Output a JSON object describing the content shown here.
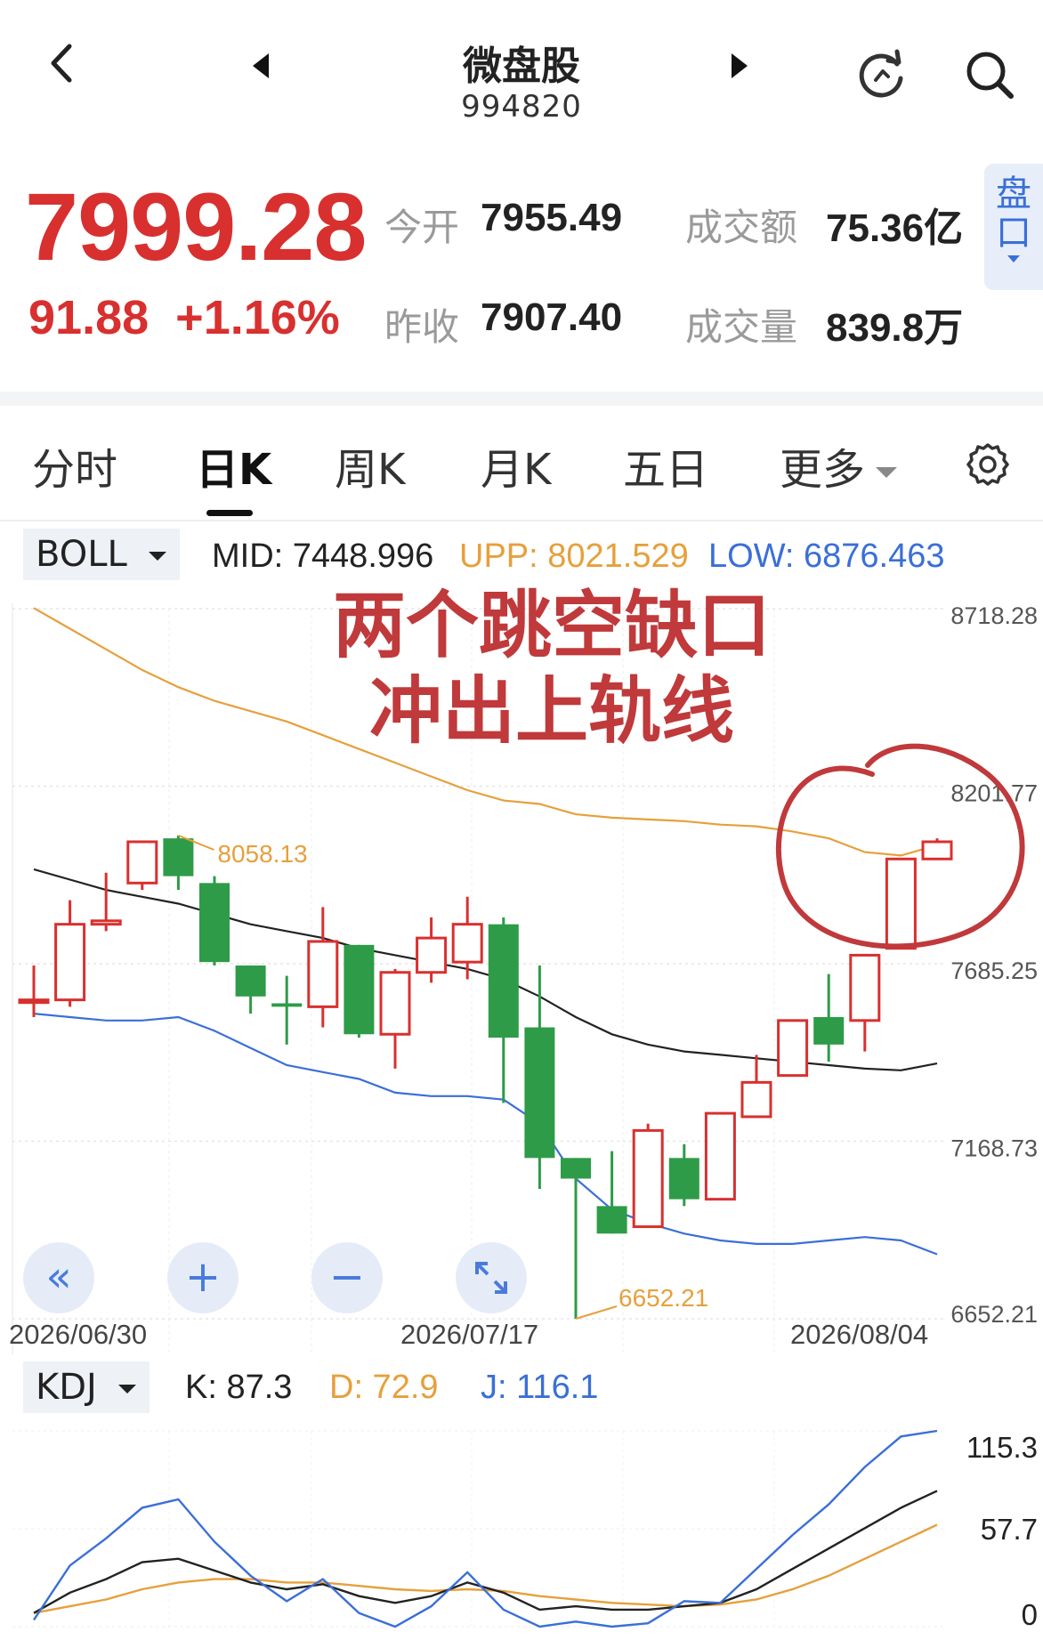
{
  "header": {
    "title": "微盘股",
    "code": "994820"
  },
  "quote": {
    "price": "7999.28",
    "change": "91.88",
    "change_pct": "+1.16%",
    "open_label": "今开",
    "open_value": "7955.49",
    "prev_close_label": "昨收",
    "prev_close_value": "7907.40",
    "amount_label": "成交额",
    "amount_value": "75.36亿",
    "volume_label": "成交量",
    "volume_value": "839.8万",
    "pankou_label": "盘口"
  },
  "tabs": [
    {
      "label": "分时"
    },
    {
      "label": "日K"
    },
    {
      "label": "周K"
    },
    {
      "label": "月K"
    },
    {
      "label": "五日"
    },
    {
      "label": "更多"
    }
  ],
  "boll": {
    "name": "BOLL",
    "mid_label": "MID:",
    "mid_value": "7448.996",
    "upp_label": "UPP:",
    "upp_value": "8021.529",
    "low_label": "LOW:",
    "low_value": "6876.463"
  },
  "annotation": {
    "line1": "两个跳空缺口",
    "line2": "冲出上轨线"
  },
  "kdj": {
    "name": "KDJ",
    "k_label": "K: 87.3",
    "d_label": "D: 72.9",
    "j_label": "J: 116.1",
    "axis_labels": [
      "115.3",
      "57.7",
      "0"
    ],
    "ylim": [
      0,
      115.3
    ]
  },
  "colors": {
    "up": "#d8302f",
    "down": "#2e9b48",
    "mid": "#222222",
    "upp": "#e6a03c",
    "low": "#3a6fd8",
    "k": "#222222",
    "d": "#e6a03c",
    "j": "#3a6fd8",
    "annotation": "#c0393b"
  },
  "chart_data": {
    "type": "candlestick",
    "ylim": [
      6652.21,
      8718.28
    ],
    "y_ticks": [
      "8718.28",
      "8201.77",
      "7685.25",
      "7168.73",
      "6652.21"
    ],
    "date_labels": [
      "2026/06/30",
      "2026/07/17",
      "2026/08/04"
    ],
    "high_marker": "8058.13",
    "low_marker": "6652.21",
    "candles": [
      {
        "o": 7580,
        "h": 7680,
        "l": 7530,
        "c": 7580
      },
      {
        "o": 7580,
        "h": 7870,
        "l": 7560,
        "c": 7800
      },
      {
        "o": 7800,
        "h": 7950,
        "l": 7780,
        "c": 7810
      },
      {
        "o": 7920,
        "h": 7985,
        "l": 7900,
        "c": 8040
      },
      {
        "o": 8050,
        "h": 8058.13,
        "l": 7900,
        "c": 7940
      },
      {
        "o": 7920,
        "h": 7940,
        "l": 7680,
        "c": 7690
      },
      {
        "o": 7680,
        "h": 7680,
        "l": 7540,
        "c": 7590
      },
      {
        "o": 7570,
        "h": 7650,
        "l": 7450,
        "c": 7560
      },
      {
        "o": 7560,
        "h": 7850,
        "l": 7500,
        "c": 7750
      },
      {
        "o": 7740,
        "h": 7740,
        "l": 7470,
        "c": 7480
      },
      {
        "o": 7480,
        "h": 7670,
        "l": 7380,
        "c": 7660
      },
      {
        "o": 7660,
        "h": 7820,
        "l": 7630,
        "c": 7760
      },
      {
        "o": 7690,
        "h": 7880,
        "l": 7640,
        "c": 7800
      },
      {
        "o": 7800,
        "h": 7820,
        "l": 7280,
        "c": 7470
      },
      {
        "o": 7500,
        "h": 7680,
        "l": 7030,
        "c": 7120
      },
      {
        "o": 7120,
        "h": 7120,
        "l": 6652.21,
        "c": 7060
      },
      {
        "o": 6980,
        "h": 7140,
        "l": 6930,
        "c": 6900
      },
      {
        "o": 6920,
        "h": 7220,
        "l": 6920,
        "c": 7200
      },
      {
        "o": 7120,
        "h": 7160,
        "l": 6980,
        "c": 7000
      },
      {
        "o": 7000,
        "h": 7250,
        "l": 7000,
        "c": 7250
      },
      {
        "o": 7240,
        "h": 7420,
        "l": 7240,
        "c": 7340
      },
      {
        "o": 7360,
        "h": 7500,
        "l": 7360,
        "c": 7520
      },
      {
        "o": 7530,
        "h": 7655,
        "l": 7400,
        "c": 7450
      },
      {
        "o": 7520,
        "h": 7620,
        "l": 7430,
        "c": 7710
      },
      {
        "o": 7730,
        "h": 7730,
        "l": 7730,
        "c": 7990
      },
      {
        "o": 7990,
        "h": 8050,
        "l": 7990,
        "c": 8040
      }
    ],
    "mid": [
      7960,
      7930,
      7900,
      7880,
      7860,
      7830,
      7800,
      7780,
      7760,
      7730,
      7710,
      7690,
      7670,
      7640,
      7590,
      7530,
      7480,
      7450,
      7430,
      7420,
      7410,
      7400,
      7390,
      7380,
      7375,
      7395
    ],
    "upp": [
      8720,
      8660,
      8600,
      8540,
      8490,
      8450,
      8420,
      8390,
      8350,
      8310,
      8270,
      8230,
      8190,
      8160,
      8150,
      8120,
      8110,
      8105,
      8100,
      8090,
      8085,
      8070,
      8050,
      8010,
      8000,
      8030
    ],
    "low": [
      7540,
      7530,
      7520,
      7520,
      7530,
      7490,
      7440,
      7390,
      7370,
      7350,
      7310,
      7300,
      7300,
      7290,
      7220,
      7060,
      6970,
      6930,
      6900,
      6880,
      6870,
      6870,
      6880,
      6890,
      6880,
      6840
    ],
    "kdj_k": [
      8,
      20,
      28,
      38,
      40,
      33,
      26,
      22,
      25,
      18,
      14,
      18,
      26,
      20,
      10,
      12,
      10,
      10,
      12,
      14,
      22,
      34,
      46,
      58,
      70,
      80
    ],
    "kdj_d": [
      8,
      12,
      16,
      22,
      26,
      28,
      28,
      26,
      26,
      24,
      22,
      21,
      22,
      21,
      18,
      16,
      14,
      13,
      12,
      13,
      16,
      22,
      30,
      40,
      50,
      60
    ],
    "kdj_j": [
      4,
      36,
      52,
      70,
      75,
      50,
      30,
      15,
      28,
      8,
      0,
      12,
      32,
      10,
      0,
      3,
      0,
      2,
      15,
      14,
      34,
      54,
      72,
      94,
      112,
      116.1
    ]
  }
}
